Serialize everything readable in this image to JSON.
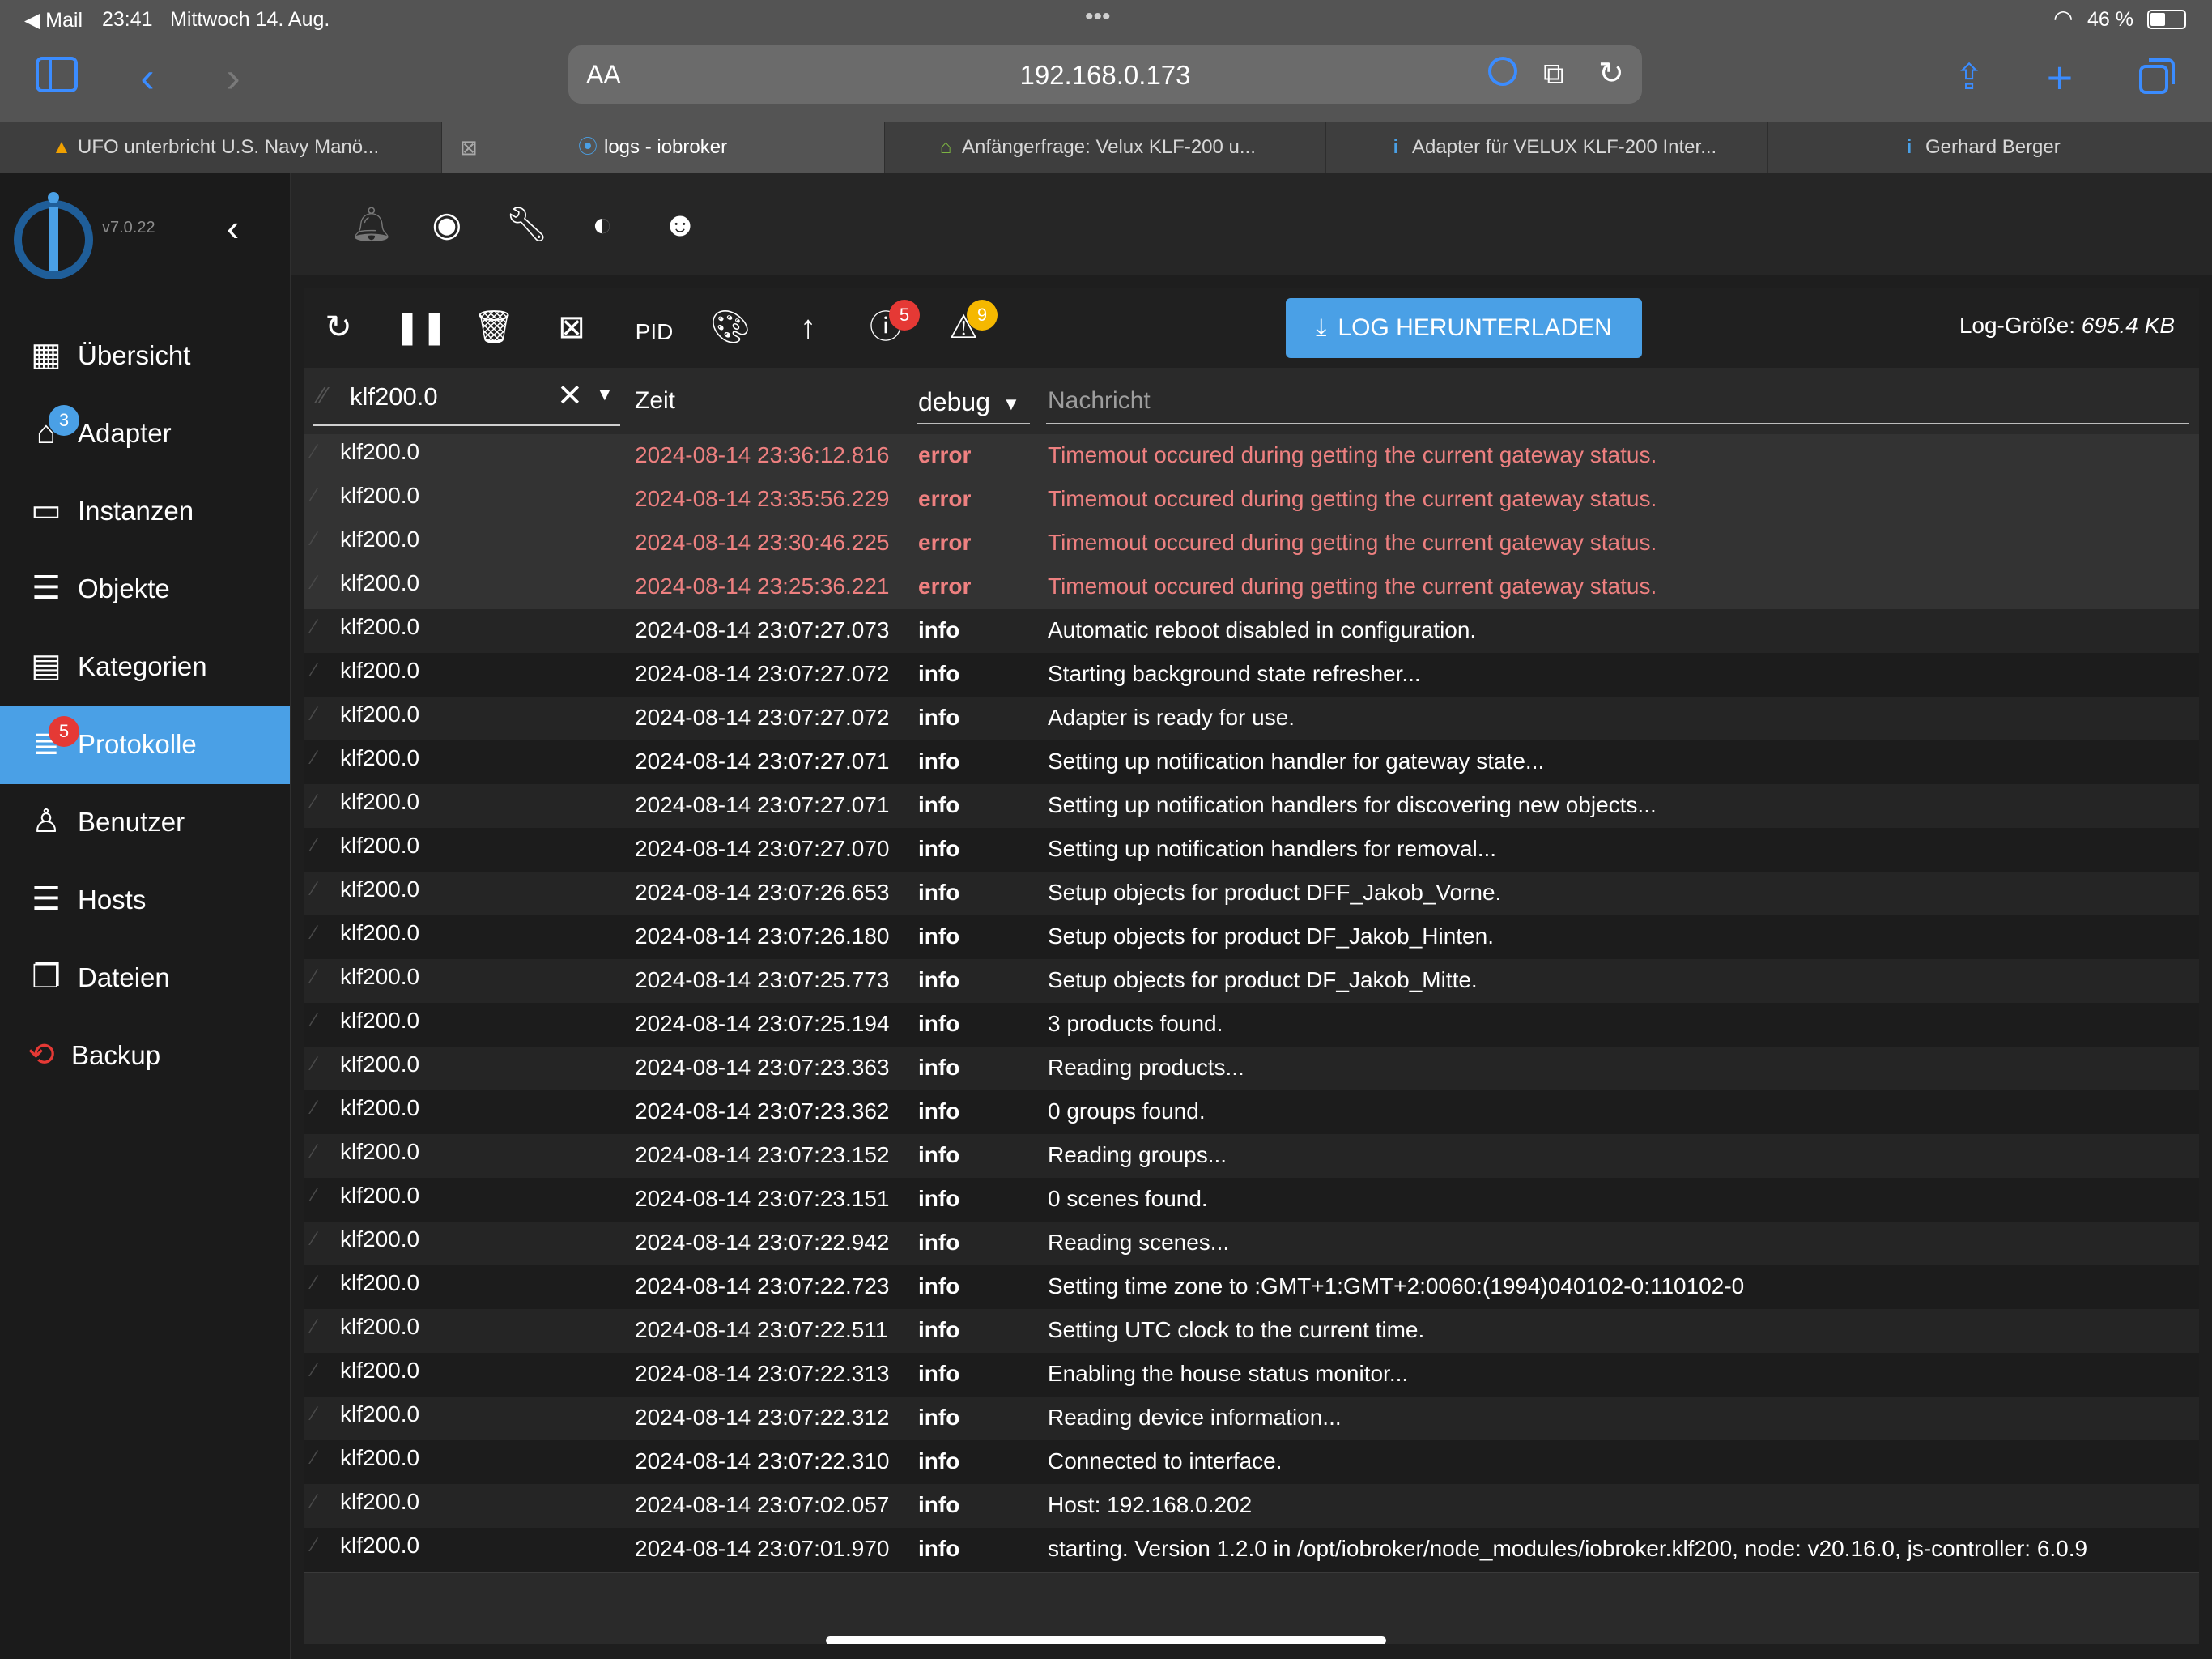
{
  "status_bar": {
    "back_app": "◀ Mail",
    "time": "23:41",
    "date": "Mittwoch 14. Aug.",
    "multitask_dots": "•••",
    "battery": "46 %"
  },
  "safari": {
    "text_size_label": "AA",
    "url": "192.168.0.173",
    "tabs": [
      {
        "title": "UFO unterbricht U.S. Navy Manö...",
        "favicon": "colored-triangle-icon"
      },
      {
        "title": "logs - iobroker",
        "favicon": "iobroker-icon"
      },
      {
        "title": "Anfängerfrage: Velux KLF-200 u...",
        "favicon": "house-icon"
      },
      {
        "title": "Adapter für VELUX KLF-200 Inter...",
        "favicon": "info-icon"
      },
      {
        "title": "Gerhard Berger",
        "favicon": "info-icon"
      }
    ]
  },
  "sidebar": {
    "version": "v7.0.22",
    "items": [
      {
        "label": "Übersicht",
        "icon": "grid-icon"
      },
      {
        "label": "Adapter",
        "icon": "store-icon",
        "badge": "3"
      },
      {
        "label": "Instanzen",
        "icon": "instances-icon"
      },
      {
        "label": "Objekte",
        "icon": "list-icon"
      },
      {
        "label": "Kategorien",
        "icon": "categories-icon"
      },
      {
        "label": "Protokolle",
        "icon": "logs-icon",
        "badge": "5",
        "active": true
      },
      {
        "label": "Benutzer",
        "icon": "user-icon"
      },
      {
        "label": "Hosts",
        "icon": "hosts-icon"
      },
      {
        "label": "Dateien",
        "icon": "files-icon"
      },
      {
        "label": "Backup",
        "icon": "backup-icon"
      }
    ]
  },
  "log_toolbar": {
    "pid_label": "PID",
    "error_badge": "5",
    "warn_badge": "9",
    "download_label": "LOG HERUNTERLADEN",
    "size_label": "Log-Größe:",
    "size_value": "695.4 KB"
  },
  "log_header": {
    "filter_value": "klf200.0",
    "col_time": "Zeit",
    "level_select": "debug",
    "col_message": "Nachricht"
  },
  "colors": {
    "accent": "#4aa0e6",
    "error_text": "#ee8080",
    "badge_red": "#e53935",
    "badge_yellow": "#f5b800"
  },
  "log_rows": [
    {
      "source": "klf200.0",
      "time": "2024-08-14 23:36:12.816",
      "severity": "error",
      "message": "Timemout occured during getting the current gateway status."
    },
    {
      "source": "klf200.0",
      "time": "2024-08-14 23:35:56.229",
      "severity": "error",
      "message": "Timemout occured during getting the current gateway status."
    },
    {
      "source": "klf200.0",
      "time": "2024-08-14 23:30:46.225",
      "severity": "error",
      "message": "Timemout occured during getting the current gateway status."
    },
    {
      "source": "klf200.0",
      "time": "2024-08-14 23:25:36.221",
      "severity": "error",
      "message": "Timemout occured during getting the current gateway status."
    },
    {
      "source": "klf200.0",
      "time": "2024-08-14 23:07:27.073",
      "severity": "info",
      "message": "Automatic reboot disabled in configuration."
    },
    {
      "source": "klf200.0",
      "time": "2024-08-14 23:07:27.072",
      "severity": "info",
      "message": "Starting background state refresher..."
    },
    {
      "source": "klf200.0",
      "time": "2024-08-14 23:07:27.072",
      "severity": "info",
      "message": "Adapter is ready for use."
    },
    {
      "source": "klf200.0",
      "time": "2024-08-14 23:07:27.071",
      "severity": "info",
      "message": "Setting up notification handler for gateway state..."
    },
    {
      "source": "klf200.0",
      "time": "2024-08-14 23:07:27.071",
      "severity": "info",
      "message": "Setting up notification handlers for discovering new objects..."
    },
    {
      "source": "klf200.0",
      "time": "2024-08-14 23:07:27.070",
      "severity": "info",
      "message": "Setting up notification handlers for removal..."
    },
    {
      "source": "klf200.0",
      "time": "2024-08-14 23:07:26.653",
      "severity": "info",
      "message": "Setup objects for product DFF_Jakob_Vorne."
    },
    {
      "source": "klf200.0",
      "time": "2024-08-14 23:07:26.180",
      "severity": "info",
      "message": "Setup objects for product DF_Jakob_Hinten."
    },
    {
      "source": "klf200.0",
      "time": "2024-08-14 23:07:25.773",
      "severity": "info",
      "message": "Setup objects for product DF_Jakob_Mitte."
    },
    {
      "source": "klf200.0",
      "time": "2024-08-14 23:07:25.194",
      "severity": "info",
      "message": "3 products found."
    },
    {
      "source": "klf200.0",
      "time": "2024-08-14 23:07:23.363",
      "severity": "info",
      "message": "Reading products..."
    },
    {
      "source": "klf200.0",
      "time": "2024-08-14 23:07:23.362",
      "severity": "info",
      "message": "0 groups found."
    },
    {
      "source": "klf200.0",
      "time": "2024-08-14 23:07:23.152",
      "severity": "info",
      "message": "Reading groups..."
    },
    {
      "source": "klf200.0",
      "time": "2024-08-14 23:07:23.151",
      "severity": "info",
      "message": "0 scenes found."
    },
    {
      "source": "klf200.0",
      "time": "2024-08-14 23:07:22.942",
      "severity": "info",
      "message": "Reading scenes..."
    },
    {
      "source": "klf200.0",
      "time": "2024-08-14 23:07:22.723",
      "severity": "info",
      "message": "Setting time zone to :GMT+1:GMT+2:0060:(1994)040102-0:110102-0"
    },
    {
      "source": "klf200.0",
      "time": "2024-08-14 23:07:22.511",
      "severity": "info",
      "message": "Setting UTC clock to the current time."
    },
    {
      "source": "klf200.0",
      "time": "2024-08-14 23:07:22.313",
      "severity": "info",
      "message": "Enabling the house status monitor..."
    },
    {
      "source": "klf200.0",
      "time": "2024-08-14 23:07:22.312",
      "severity": "info",
      "message": "Reading device information..."
    },
    {
      "source": "klf200.0",
      "time": "2024-08-14 23:07:22.310",
      "severity": "info",
      "message": "Connected to interface."
    },
    {
      "source": "klf200.0",
      "time": "2024-08-14 23:07:02.057",
      "severity": "info",
      "message": "Host: 192.168.0.202"
    },
    {
      "source": "klf200.0",
      "time": "2024-08-14 23:07:01.970",
      "severity": "info",
      "message": "starting. Version 1.2.0 in /opt/iobroker/node_modules/iobroker.klf200, node: v20.16.0, js-controller: 6.0.9"
    }
  ]
}
